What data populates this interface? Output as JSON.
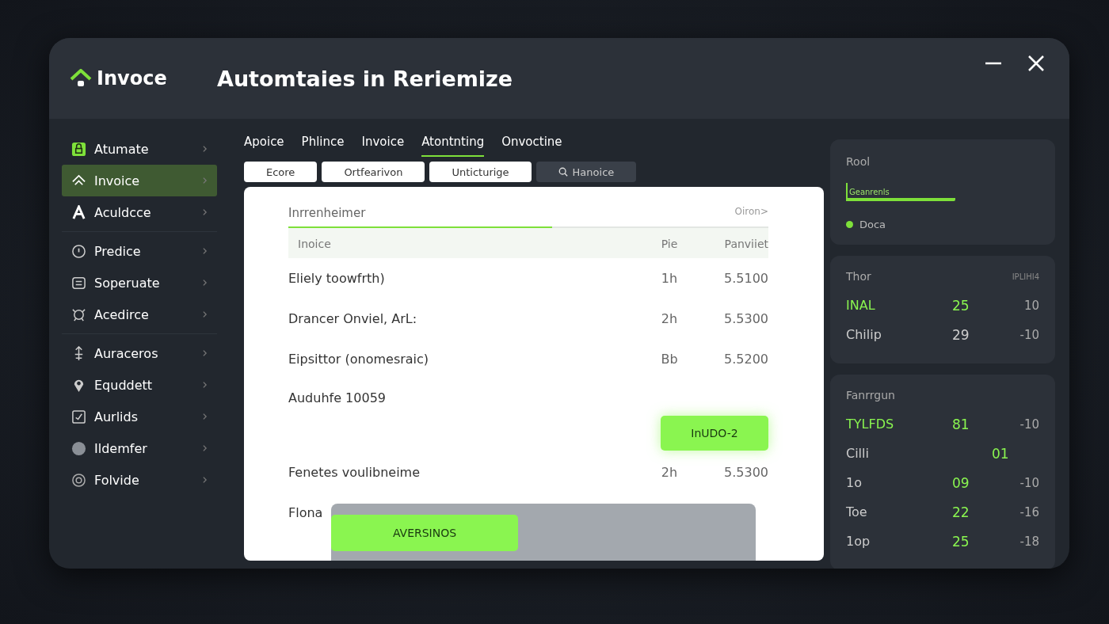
{
  "window": {
    "app_name": "Invoce",
    "title": "Automtaies in Reriemize"
  },
  "sidebar": {
    "groups": [
      [
        {
          "label": "Atumate",
          "selected": false
        },
        {
          "label": "Invoice",
          "selected": true
        },
        {
          "label": "Aculdcce",
          "selected": false
        }
      ],
      [
        {
          "label": "Predice",
          "selected": false
        },
        {
          "label": "Soperuate",
          "selected": false
        },
        {
          "label": "Acedirce",
          "selected": false
        }
      ],
      [
        {
          "label": "Auraceros",
          "selected": false
        },
        {
          "label": "Equddett",
          "selected": false
        },
        {
          "label": "Aurlids",
          "selected": false
        },
        {
          "label": "Ildemfer",
          "selected": false
        },
        {
          "label": "Folvide",
          "selected": false
        }
      ]
    ]
  },
  "tabs": [
    {
      "label": "Apoice",
      "selected": false
    },
    {
      "label": "Phlince",
      "selected": false
    },
    {
      "label": "Invoice",
      "selected": false
    },
    {
      "label": "Atontnting",
      "selected": true
    },
    {
      "label": "Onvoctine",
      "selected": false
    }
  ],
  "filters": [
    {
      "label": "Ecore",
      "kind": "light"
    },
    {
      "label": "Ortfearivon",
      "kind": "light"
    },
    {
      "label": "Unticturige",
      "kind": "light"
    },
    {
      "label": "Hanoice",
      "kind": "search"
    }
  ],
  "table": {
    "title": "Inrrenheimer",
    "link": "Oiron>",
    "level": 0.55,
    "columns": [
      "Inoice",
      "Pie",
      "Panviiet"
    ],
    "rows": [
      {
        "cells": [
          "Eliely toowfrth)",
          "1h",
          "5.5100"
        ]
      },
      {
        "cells": [
          "Drancer Onviel, ArL:",
          "2h",
          "5.5300"
        ]
      },
      {
        "cells": [
          "Eipsittor (onomesraic)",
          "Bb",
          "5.5200"
        ]
      },
      {
        "cells": [
          "Auduhfe 10059"
        ]
      },
      {
        "cells": [
          "Fenetes voulibneime",
          "2h",
          "5.5300"
        ]
      },
      {
        "cells": [
          "Flona"
        ]
      }
    ],
    "action_button": "InUDO-2",
    "overlay_button": "AVERSINOS"
  },
  "panels": [
    {
      "kind": "summary",
      "title": "Rool",
      "bar_label": "Geanrenls",
      "legend": {
        "label": "Doca",
        "color": "#7ee03a"
      }
    },
    {
      "kind": "stats",
      "title": "Thor",
      "header_right": "IPLIHI4",
      "rows": [
        {
          "cells": [
            "INAL",
            "25",
            "10"
          ],
          "highlight": true,
          "value_accent": true
        },
        {
          "cells": [
            "Chilip",
            "29",
            "-10"
          ],
          "highlight": false,
          "value_accent": false
        }
      ]
    },
    {
      "kind": "stats",
      "title": "Fanrrgun",
      "rows": [
        {
          "cells": [
            "TYLFDS",
            "81",
            "-10"
          ],
          "highlight": true,
          "value_accent": true
        },
        {
          "cells": [
            "Cilli",
            "01"
          ],
          "highlight": false,
          "value_accent": true
        },
        {
          "cells": [
            "1o",
            "09",
            "-10"
          ],
          "highlight": false,
          "value_accent": true
        },
        {
          "cells": [
            "Toe",
            "22",
            "-16"
          ],
          "highlight": false,
          "value_accent": true
        },
        {
          "cells": [
            "1op",
            "25",
            "-18"
          ],
          "highlight": false,
          "value_accent": true
        }
      ]
    }
  ]
}
